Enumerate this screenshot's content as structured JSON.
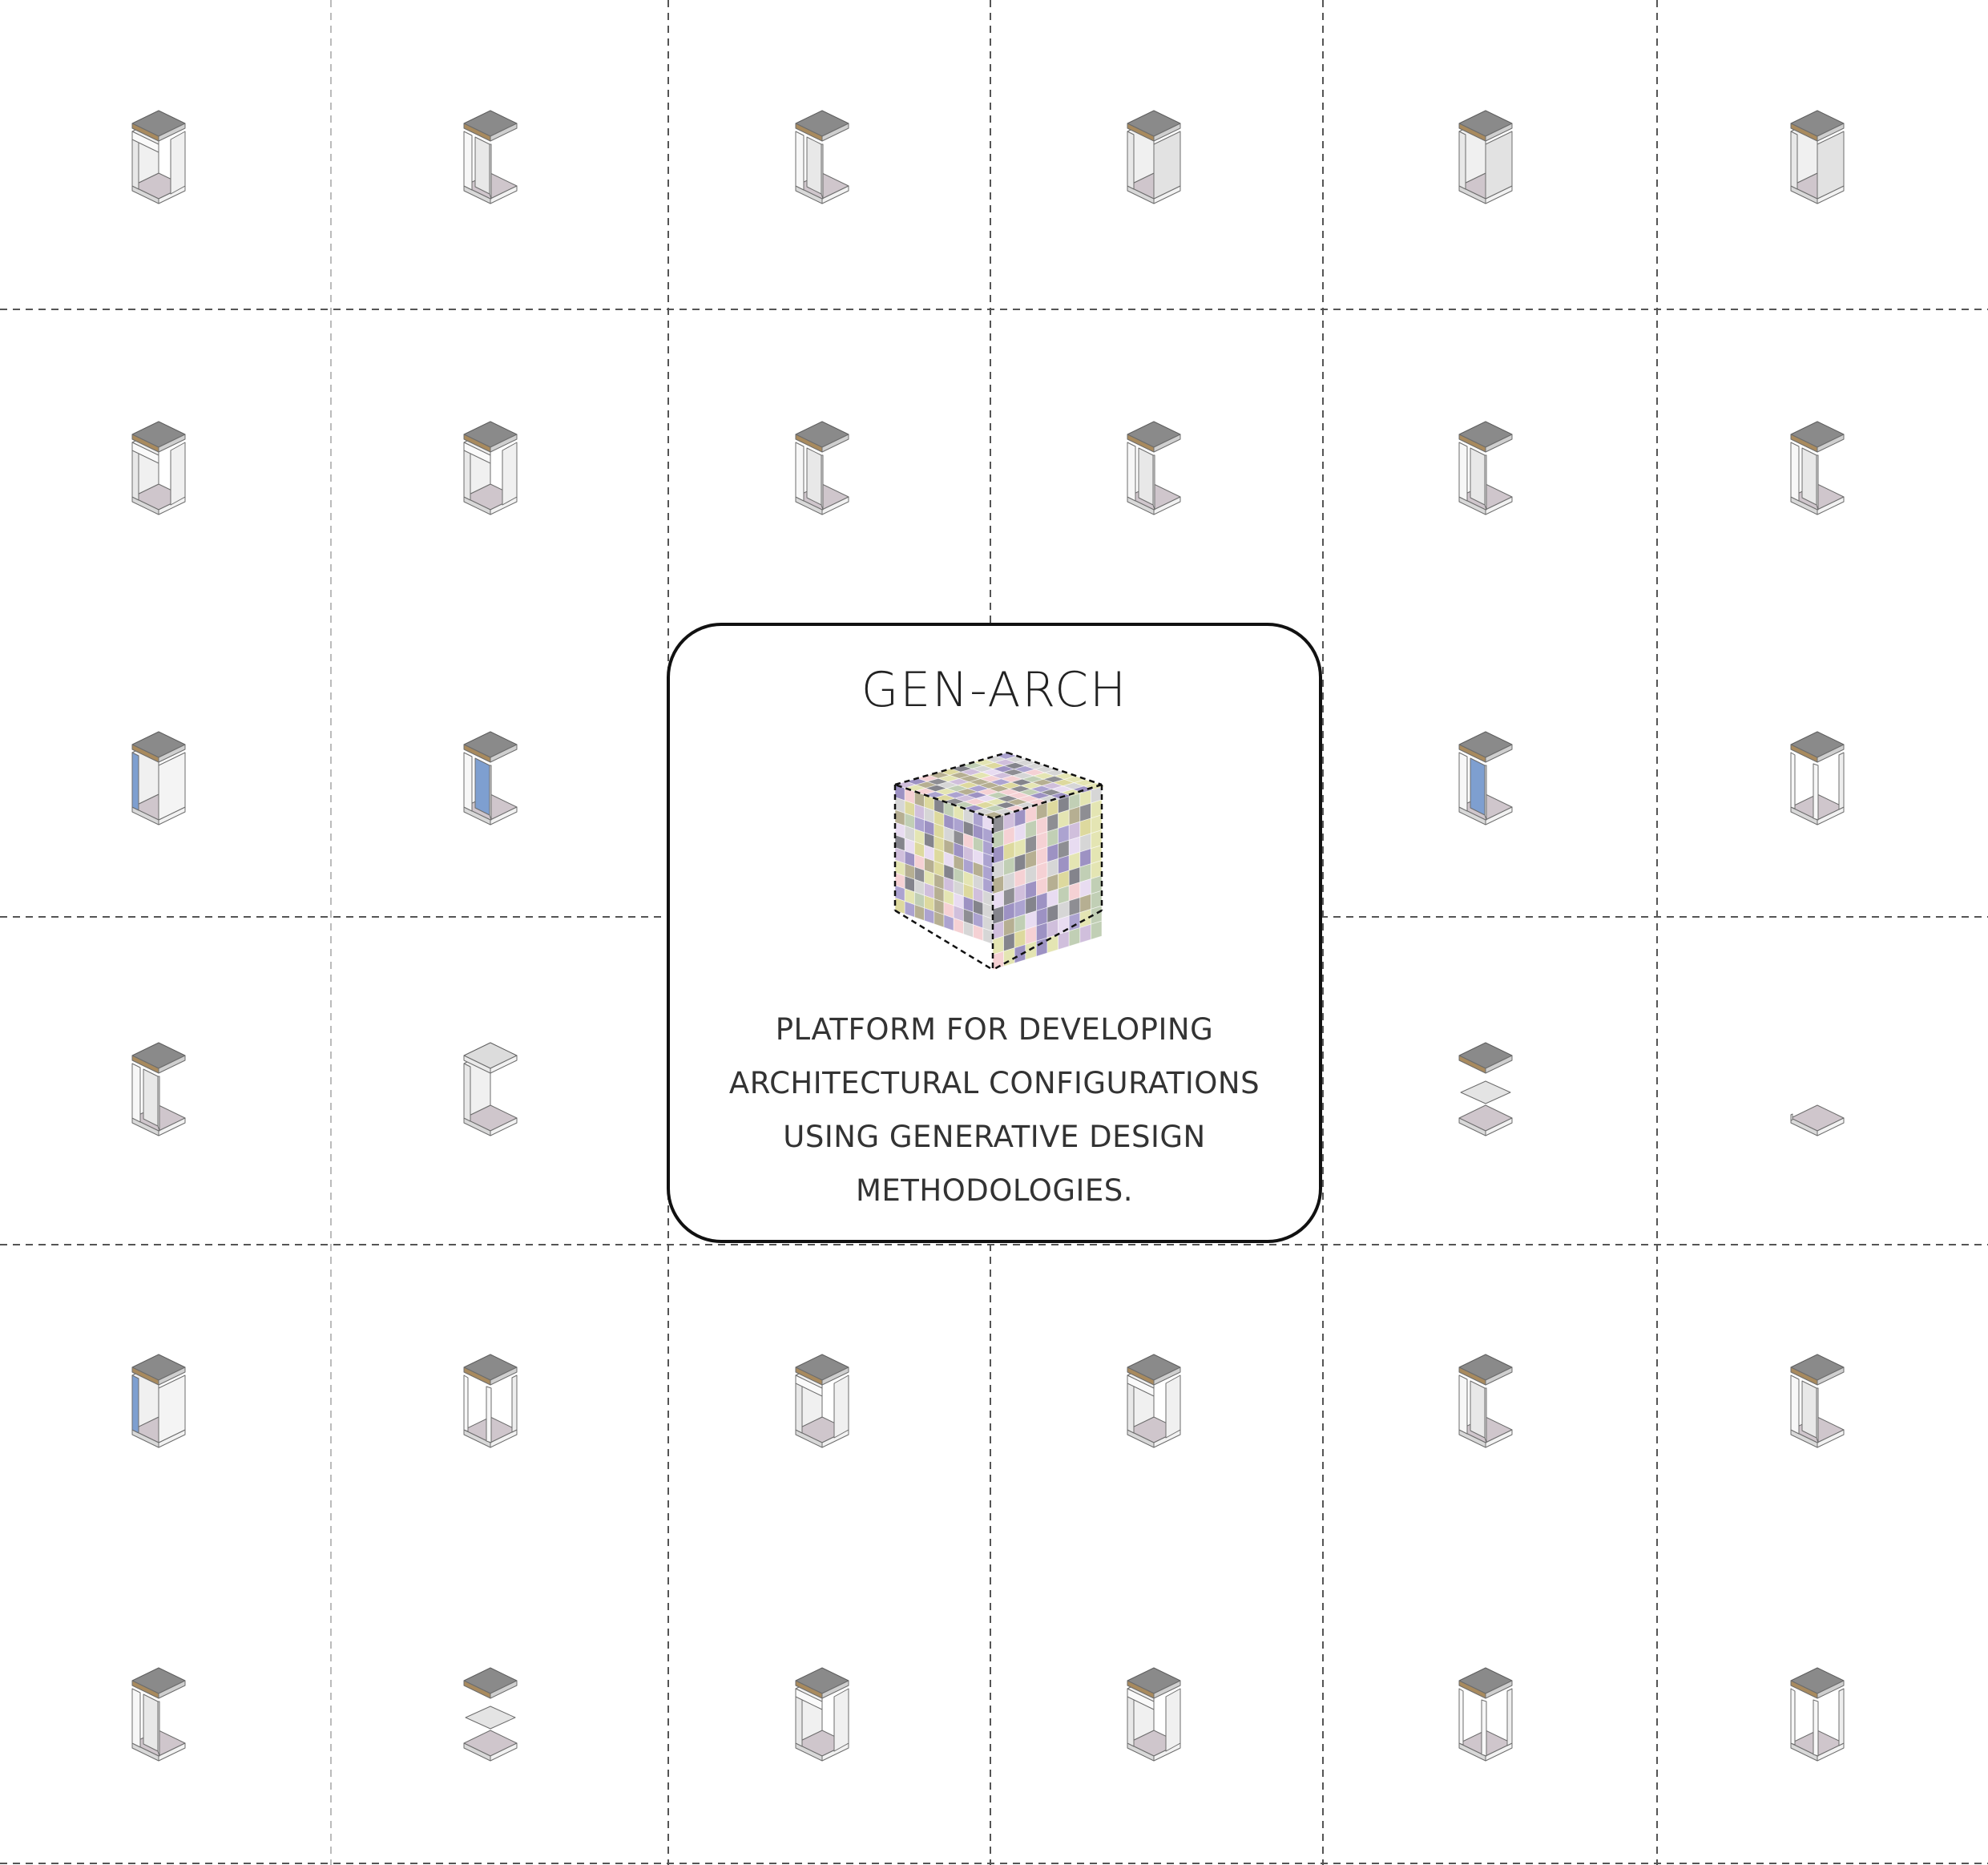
{
  "card": {
    "title": "GEN-ARCH",
    "description_lines": [
      "PLATFORM FOR DEVELOPING",
      "ARCHITECTURAL CONFIGURATIONS",
      "USING GENERATIVE DESIGN",
      "METHODOLOGIES."
    ]
  },
  "colors": {
    "roof": "#8a8a8a",
    "roof_edge": "#a88a5e",
    "floor": "#cfc6cc",
    "wall": "#e8e8e8",
    "glass": "#7e9fd0",
    "grid_line": "#555555",
    "card_border": "#111111"
  },
  "icons": {
    "cell_icon": "isometric-module-icon",
    "card_icon": "voxel-cube-icon"
  },
  "modules": [
    {
      "variant": "c-open",
      "glass": false
    },
    {
      "variant": "frame",
      "glass": false
    },
    {
      "variant": "frame",
      "glass": false
    },
    {
      "variant": "closed",
      "glass": false
    },
    {
      "variant": "closed",
      "glass": false
    },
    {
      "variant": "closed",
      "glass": false
    },
    {
      "variant": "c-open",
      "glass": false
    },
    {
      "variant": "c-open",
      "glass": false
    },
    {
      "variant": "frame",
      "glass": false
    },
    {
      "variant": "frame",
      "glass": false
    },
    {
      "variant": "frame",
      "glass": false
    },
    {
      "variant": "frame",
      "glass": false
    },
    {
      "variant": "closed",
      "glass": true
    },
    {
      "variant": "frame",
      "glass": true
    },
    null,
    null,
    {
      "variant": "frame",
      "glass": true
    },
    {
      "variant": "posts",
      "glass": false
    },
    {
      "variant": "frame",
      "glass": false
    },
    {
      "variant": "no-roof",
      "glass": false
    },
    null,
    null,
    {
      "variant": "split",
      "glass": false
    },
    {
      "variant": "base-only",
      "glass": false
    },
    {
      "variant": "closed",
      "glass": true
    },
    {
      "variant": "posts",
      "glass": false
    },
    {
      "variant": "c-open",
      "glass": false
    },
    {
      "variant": "c-open",
      "glass": false
    },
    {
      "variant": "frame",
      "glass": false
    },
    {
      "variant": "frame",
      "glass": false
    },
    {
      "variant": "frame",
      "glass": false
    },
    {
      "variant": "split",
      "glass": false
    },
    {
      "variant": "c-open",
      "glass": false
    },
    {
      "variant": "c-open",
      "glass": false
    },
    {
      "variant": "posts",
      "glass": false
    },
    {
      "variant": "posts",
      "glass": false
    }
  ]
}
